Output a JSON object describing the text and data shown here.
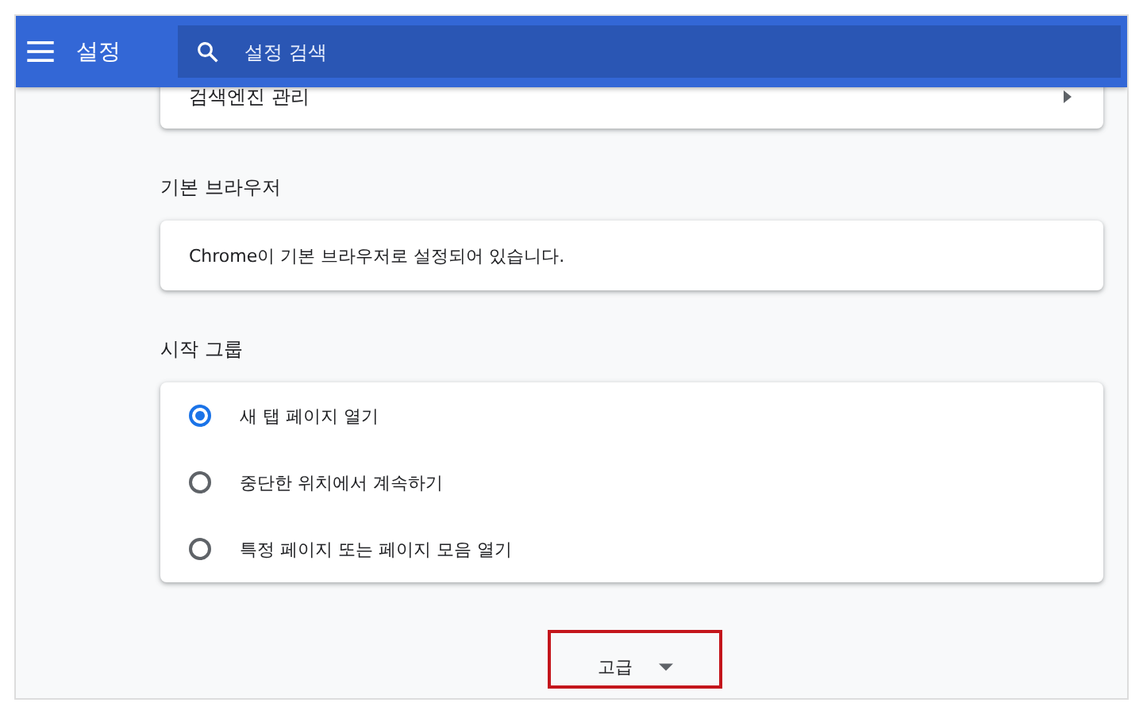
{
  "header": {
    "title": "설정",
    "search": {
      "placeholder": "설정 검색"
    }
  },
  "top_card": {
    "label": "검색엔진 관리"
  },
  "sections": [
    {
      "heading": "기본 브라우저",
      "kind": "text",
      "text": "Chrome이 기본 브라우저로 설정되어 있습니다."
    },
    {
      "heading": "시작 그룹",
      "kind": "radio",
      "options": [
        {
          "label": "새 탭 페이지 열기",
          "selected": true
        },
        {
          "label": "중단한 위치에서 계속하기",
          "selected": false
        },
        {
          "label": "특정 페이지 또는 페이지 모음 열기",
          "selected": false
        }
      ]
    }
  ],
  "advanced": {
    "label": "고급",
    "highlighted": true
  }
}
